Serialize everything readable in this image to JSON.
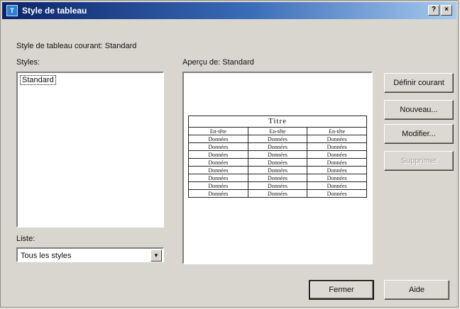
{
  "window": {
    "title": "Style de tableau",
    "app_icon": "autocad-table-icon",
    "help_button": "?",
    "close_button": "×"
  },
  "current_style_label": "Style de tableau courant: Standard",
  "styles": {
    "label": "Styles:",
    "items": [
      "Standard"
    ]
  },
  "filter": {
    "label": "Liste:",
    "value": "Tous les styles"
  },
  "preview": {
    "label": "Aperçu de: Standard",
    "table": {
      "title": "Titre",
      "headers": [
        "En-tête",
        "En-tête",
        "En-tête"
      ],
      "rows": [
        [
          "Données",
          "Données",
          "Données"
        ],
        [
          "Données",
          "Données",
          "Données"
        ],
        [
          "Données",
          "Données",
          "Données"
        ],
        [
          "Données",
          "Données",
          "Données"
        ],
        [
          "Données",
          "Données",
          "Données"
        ],
        [
          "Données",
          "Données",
          "Données"
        ],
        [
          "Données",
          "Données",
          "Données"
        ],
        [
          "Données",
          "Données",
          "Données"
        ]
      ]
    }
  },
  "buttons": {
    "set_current": "Définir courant",
    "new": "Nouveau...",
    "modify": "Modifier...",
    "delete": "Supprimer",
    "close": "Fermer",
    "help": "Aide"
  }
}
